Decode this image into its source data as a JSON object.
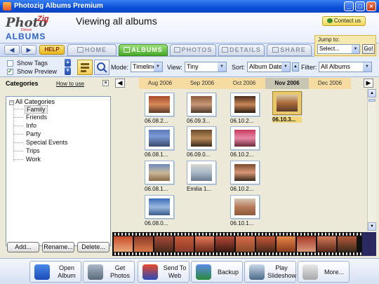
{
  "window": {
    "title": "Photozig Albums Premium"
  },
  "header": {
    "logo_photo": "Photo",
    "logo_zig": "Zig",
    "logo_albums": "ALBUMS",
    "logo_tagline": "Deluxe",
    "view_title": "Viewing all albums",
    "contact_label": "Contact us",
    "jump_label": "Jump to:",
    "jump_value": "Select...",
    "go_label": "Go!"
  },
  "nav": {
    "help_label": "HELP",
    "tabs": [
      {
        "label": "HOME"
      },
      {
        "label": "ALBUMS"
      },
      {
        "label": "PHOTOS"
      },
      {
        "label": "DETAILS"
      },
      {
        "label": "SHARE"
      }
    ]
  },
  "toolbar": {
    "show_tags": "Show Tags",
    "show_preview": "Show Preview",
    "show_tags_checked": false,
    "show_preview_checked": true,
    "mode_label": "Mode:",
    "mode_value": "Timeline",
    "view_label": "View:",
    "view_value": "Tiny",
    "sort_label": "Sort:",
    "sort_value": "Album Date",
    "filter_label": "Filter:",
    "filter_value": "All Albums"
  },
  "categories": {
    "title": "Categories",
    "how_to": "How to use",
    "root": "All Categories",
    "items": [
      "Family",
      "Friends",
      "Info",
      "Party",
      "Special Events",
      "Trips",
      "Work"
    ],
    "selected": "Family",
    "buttons": {
      "add": "Add...",
      "rename": "Rename...",
      "delete": "Delete..."
    }
  },
  "timeline": {
    "months": [
      "Aug 2006",
      "Sep 2006",
      "Oct 2006",
      "Nov 2006",
      "Dec 2006"
    ],
    "active": "Nov 2006"
  },
  "albums": {
    "aug": [
      "06.08.2...",
      "06.08.1...",
      "06.08.1...",
      "06.08.0..."
    ],
    "sep": [
      "06.09.3...",
      "06.09.0...",
      "Emilia 1..."
    ],
    "oct": [
      "06.10.2...",
      "06.10.2...",
      "06.10.2...",
      "06.10.1..."
    ],
    "nov": [
      "06.10.3..."
    ]
  },
  "bottom": {
    "open_album": "Open\nAlbum",
    "get_photos": "Get\nPhotos",
    "send_to_web": "Send To\nWeb",
    "backup": "Backup",
    "play_slideshow": "Play\nSlideshow",
    "more": "More..."
  }
}
